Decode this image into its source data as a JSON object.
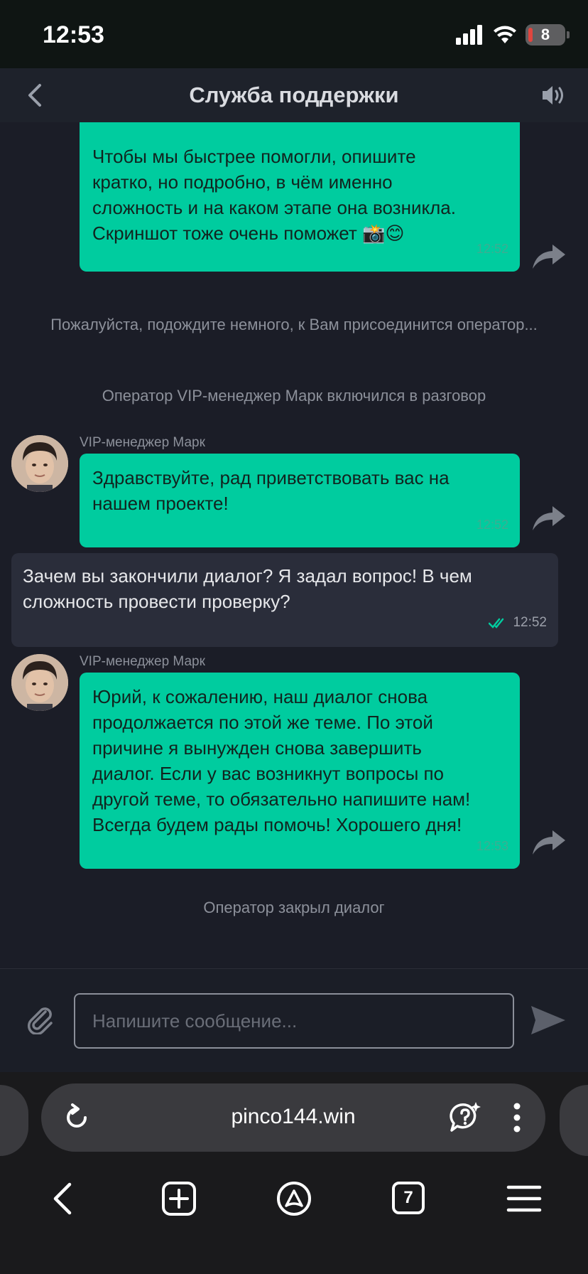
{
  "status_bar": {
    "time": "12:53",
    "battery": "8"
  },
  "header": {
    "title": "Служба поддержки"
  },
  "messages": {
    "op_msg1": {
      "lines": [
        "Чтобы мы быстрее помогли, опишите",
        "кратко, но подробно, в чём именно",
        "сложность и на каком этапе она возникла.",
        "Скриншот тоже очень поможет 📸😊"
      ],
      "time": "12:52"
    },
    "sys_wait": "Пожалуйста, подождите немного, к Вам присоединится оператор...",
    "sys_joined": "Оператор VIP-менеджер Марк включился в разговор",
    "op_msg2": {
      "sender": "VIP-менеджер Марк",
      "lines": [
        "Здравствуйте, рад приветствовать вас на",
        "нашем проекте!"
      ],
      "time": "12:52"
    },
    "user_msg": {
      "lines": [
        "Зачем вы закончили диалог? Я задал вопрос! В чем",
        "сложность провести проверку?"
      ],
      "time": "12:52"
    },
    "op_msg3": {
      "sender": "VIP-менеджер Марк",
      "lines": [
        "Юрий, к сожалению, наш диалог снова",
        "продолжается по этой же теме. По этой",
        "причине я вынужден снова завершить",
        "диалог. Если у вас возникнут вопросы по",
        "другой теме, то обязательно напишите нам!",
        "Всегда будем рады помочь! Хорошего дня!"
      ],
      "time": "12:53"
    },
    "sys_closed": "Оператор закрыл диалог"
  },
  "composer": {
    "placeholder": "Напишите сообщение..."
  },
  "browser": {
    "url": "pinco144.win",
    "tabs_count": "7"
  },
  "colors": {
    "accent_green": "#00cc9f",
    "background": "#1b1d27",
    "user_bubble": "#2a2d3a"
  }
}
